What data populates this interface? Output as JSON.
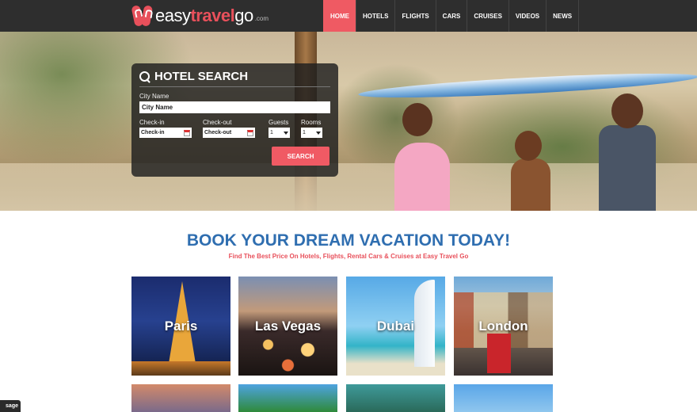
{
  "brand": {
    "part1": "easy",
    "part2": "travel",
    "part3": "go",
    "suffix": ".com"
  },
  "nav": {
    "items": [
      {
        "label": "HOME",
        "active": true
      },
      {
        "label": "HOTELS"
      },
      {
        "label": "FLIGHTS"
      },
      {
        "label": "CARS"
      },
      {
        "label": "CRUISES"
      },
      {
        "label": "VIDEOS"
      },
      {
        "label": "NEWS"
      }
    ]
  },
  "search": {
    "title": "HOTEL SEARCH",
    "city_label": "City Name",
    "city_value": "City Name",
    "checkin_label": "Check-in",
    "checkin_value": "Check-in",
    "checkout_label": "Check-out",
    "checkout_value": "Check-out",
    "guests_label": "Guests",
    "guests_value": "1",
    "rooms_label": "Rooms",
    "rooms_value": "1",
    "button": "SEARCH"
  },
  "main": {
    "headline": "BOOK YOUR DREAM VACATION TODAY!",
    "subline": "Find The Best Price On Hotels, Flights, Rental Cars & Cruises at Easy Travel Go",
    "destinations": [
      "Paris",
      "Las Vegas",
      "Dubai",
      "London"
    ]
  },
  "message_tab": "sage",
  "colors": {
    "accent": "#ef5a63",
    "headline": "#2f6eb0",
    "navbar": "#2e2e2e"
  }
}
